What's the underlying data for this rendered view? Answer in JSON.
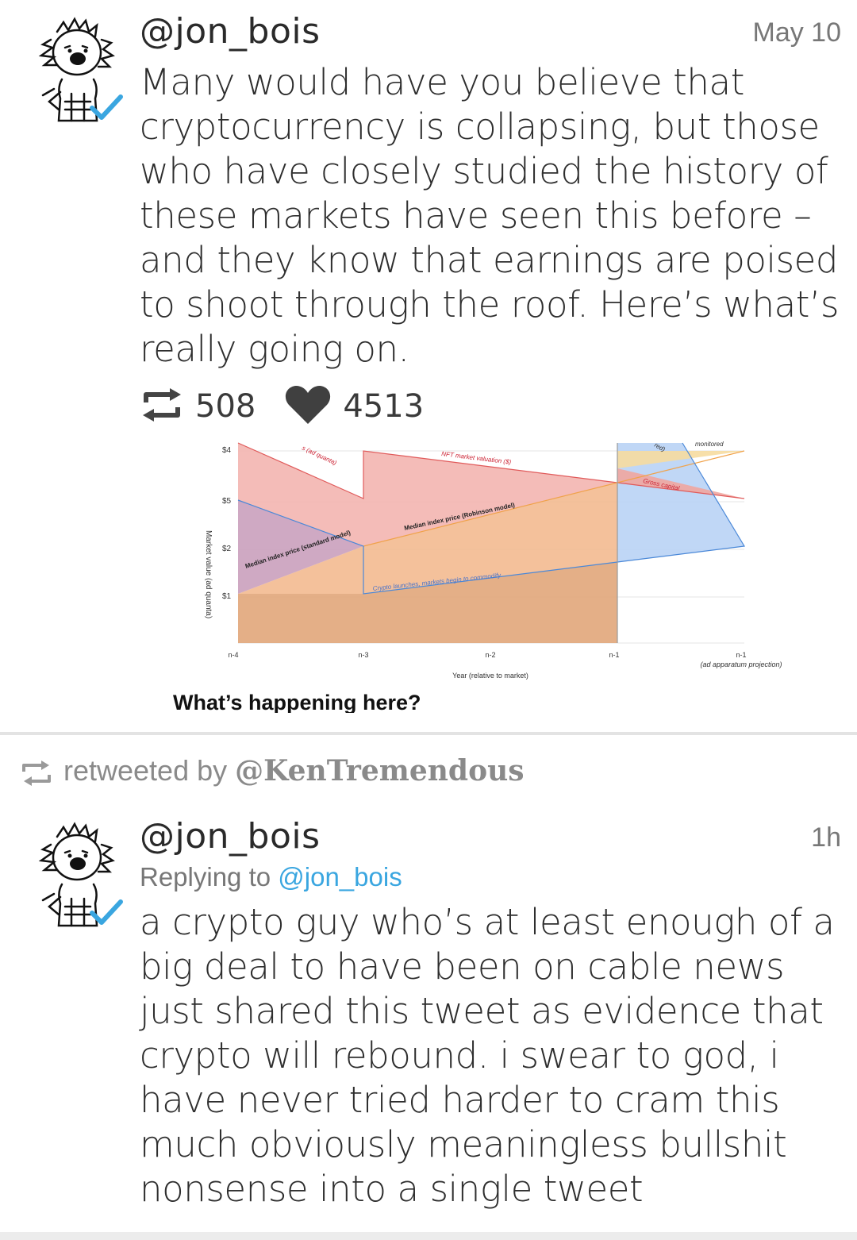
{
  "tweet1": {
    "handle": "@jon_bois",
    "time": "May 10",
    "text": "Many would have you believe that cryptocurrency is collapsing, but those who have closely studied the history of these markets have seen this before – and they know that earnings are poised to shoot through the roof. Here’s what’s really going on.",
    "retweets": "508",
    "likes": "4513",
    "verified_icon": "verified-check-icon",
    "retweet_icon": "retweet-icon",
    "like_icon": "heart-icon",
    "chart": {
      "ylabel": "Market value (ad quanta)",
      "yticks": [
        "$4",
        "$5",
        "$2",
        "$1"
      ],
      "xticks": [
        "n-4",
        "n-3",
        "n-2",
        "n-1",
        "n-1"
      ],
      "xtick_note": "(ad apparatum projection)",
      "xlabel": "Year (relative to market)",
      "annotations": {
        "ad_quanta": "s (ad quanta)",
        "nft": "NFT market valuation ($)",
        "robinson": "Median index price (Robinson model)",
        "standard": "Median index price (standard model)",
        "crypto": "Crypto launches, markets begin to commodify",
        "gross": "Gross capital",
        "monitored": "monitored",
        "red": "red)"
      },
      "caption": "What’s happening here?"
    }
  },
  "retweet_bar": {
    "prefix": "retweeted by ",
    "user": "@KenTremendous"
  },
  "tweet2": {
    "handle": "@jon_bois",
    "time": "1h",
    "replying_prefix": "Replying to ",
    "replying_user": "@jon_bois",
    "text": "a crypto guy who’s at least enough of a big deal to have been on cable news just shared this tweet as evidence that crypto will rebound. i swear to god, i have never tried harder to cram this much obviously meaningless bullshit nonsense into a single tweet"
  },
  "colors": {
    "accent_blue": "#3aa6e0",
    "text_dark": "#2e2e2e",
    "text_muted": "#8a8a8a"
  }
}
